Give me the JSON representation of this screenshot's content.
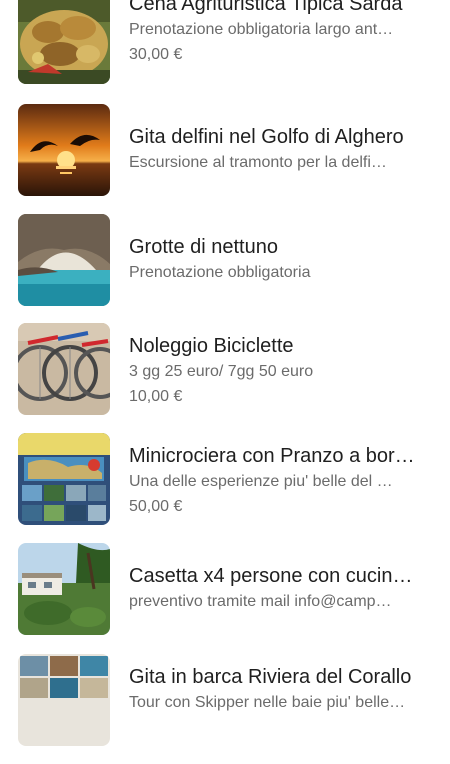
{
  "products": [
    {
      "title": "Cena Agrituristica Tipica Sarda",
      "description": "Prenotazione obbligatoria largo ant…",
      "price": "30,00 €",
      "image": "food-plate-image"
    },
    {
      "title": "Gita delfini nel Golfo di Alghero",
      "description": "Escursione al tramonto per la delfi…",
      "price": "",
      "image": "sunset-dolphins-image"
    },
    {
      "title": "Grotte di nettuno",
      "description": "Prenotazione obbligatoria",
      "price": "",
      "image": "sea-cave-image"
    },
    {
      "title": "Noleggio Biciclette",
      "description": "3 gg 25 euro/ 7gg 50 euro",
      "price": "10,00 €",
      "image": "bicycles-image"
    },
    {
      "title": "Minicrociera con Pranzo a bor…",
      "description": "Una delle esperienze piu' belle del …",
      "price": "50,00 €",
      "image": "cruise-flyer-image"
    },
    {
      "title": "Casetta x4 persone con cucin…",
      "description": "preventivo tramite mail info@camp…",
      "price": "",
      "image": "campsite-house-image"
    },
    {
      "title": "Gita in barca Riviera del Corallo",
      "description": "Tour con Skipper nelle baie piu' belle…",
      "price": "",
      "image": "boat-trip-collage-image"
    }
  ]
}
